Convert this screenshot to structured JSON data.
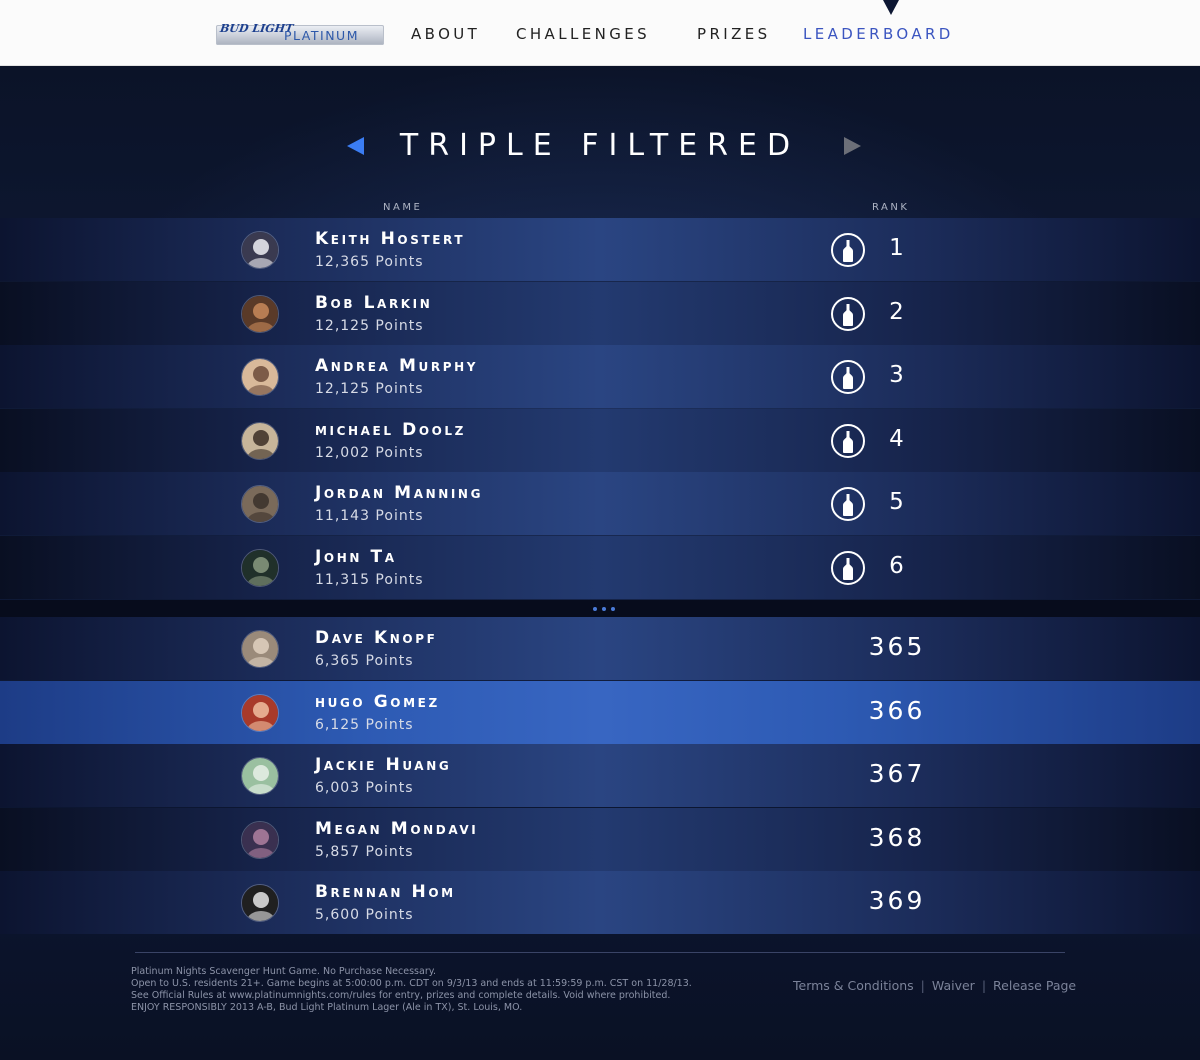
{
  "brand": {
    "logo_bud": "BUD LIGHT",
    "logo_platinum": "PLATINUM"
  },
  "nav": {
    "items": [
      "ABOUT",
      "CHALLENGES",
      "PRIZES",
      "LEADERBOARD"
    ],
    "active": "LEADERBOARD"
  },
  "leaderboard": {
    "category": "TRIPLE FILTERED",
    "col_name": "NAME",
    "col_rank": "RANK",
    "top_rows": [
      {
        "name": "Keith Hostert",
        "points": "12,365 Points",
        "rank": "1"
      },
      {
        "name": "Bob Larkin",
        "points": "12,125 Points",
        "rank": "2"
      },
      {
        "name": "Andrea Murphy",
        "points": "12,125 Points",
        "rank": "3"
      },
      {
        "name": "michael Doolz",
        "points": "12,002 Points",
        "rank": "4"
      },
      {
        "name": "Jordan Manning",
        "points": "11,143 Points",
        "rank": "5"
      },
      {
        "name": "John Ta",
        "points": "11,315 Points",
        "rank": "6"
      }
    ],
    "more_rows": [
      {
        "name": "Dave Knopf",
        "points": "6,365 Points",
        "rank": "365"
      },
      {
        "name": "hugo Gomez",
        "points": "6,125 Points",
        "rank": "366"
      },
      {
        "name": "Jackie Huang",
        "points": "6,003 Points",
        "rank": "367"
      },
      {
        "name": "Megan Mondavi",
        "points": "5,857 Points",
        "rank": "368"
      },
      {
        "name": "Brennan Hom",
        "points": "5,600 Points",
        "rank": "369"
      }
    ]
  },
  "footer": {
    "legal": [
      "Platinum Nights Scavenger Hunt Game. No Purchase Necessary.",
      "Open to U.S. residents 21+. Game begins at 5:00:00 p.m. CDT on 9/3/13 and ends at 11:59:59 p.m. CST on 11/28/13.",
      "See Official Rules at www.platinumnights.com/rules for entry, prizes and complete details.  Void where prohibited.",
      "ENJOY RESPONSIBLY 2013 A-B, Bud Light Platinum Lager (Ale in TX), St. Louis, MO."
    ],
    "links": [
      "Terms & Conditions",
      "Waiver",
      "Release Page"
    ]
  },
  "colors": {
    "accent": "#3b55c0",
    "arrow_active": "#3b7df3",
    "arrow_inactive": "#6c6f78",
    "highlight_row": "#3866c2"
  },
  "icons": {
    "bottle": "bottle-icon",
    "prev": "arrow-left-icon",
    "next": "arrow-right-icon"
  }
}
